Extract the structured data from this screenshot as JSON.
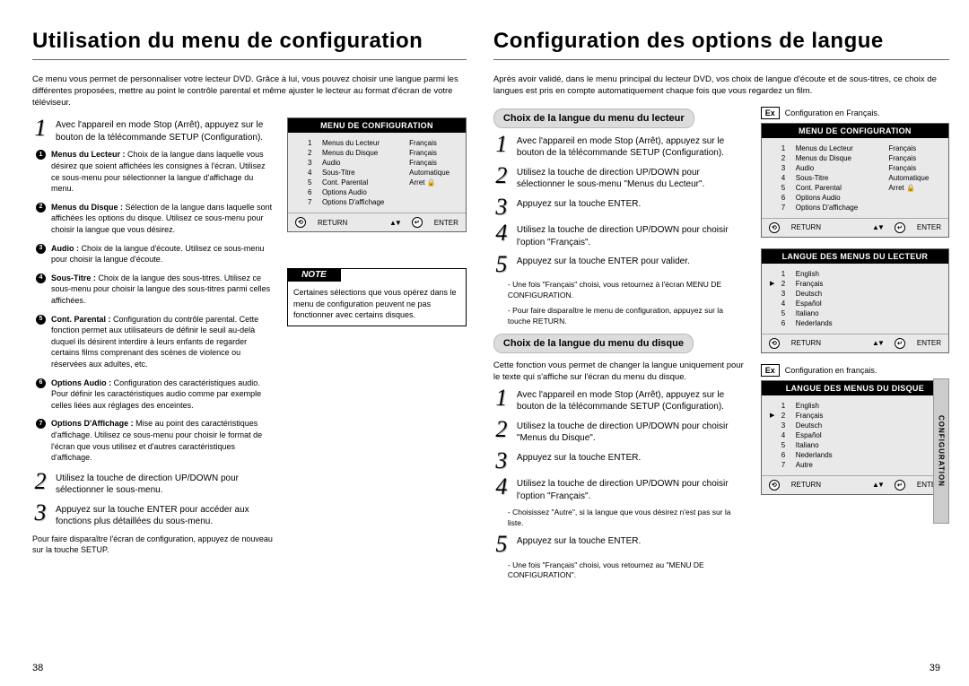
{
  "left": {
    "title": "Utilisation du menu de configuration",
    "intro": "Ce menu vous permet de personnaliser votre lecteur DVD. Grâce à lui, vous pouvez choisir une langue parmi les différentes proposées, mettre au point le contrôle parental et même ajuster le lecteur au format d'écran de votre téléviseur.",
    "step1": "Avec l'appareil en mode Stop (Arrêt), appuyez sur le bouton de la télécommande SETUP (Configuration).",
    "b1t": "Menus du Lecteur :",
    "b1": "Choix de la langue dans laquelle vous désirez que soient affichées les consignes à l'écran.\nUtilisez ce sous-menu pour sélectionner la langue d'affichage du menu.",
    "b2t": "Menus du Disque :",
    "b2": "Sélection de la langue dans laquelle sont affichées les options du disque. Utilisez ce sous-menu pour choisir la langue que vous désirez.",
    "b3t": "Audio :",
    "b3": "Choix de la langue d'écoute.\nUtilisez ce sous-menu pour choisir la langue d'écoute.",
    "b4t": "Sous-Titre :",
    "b4": "Choix de la langue des sous-titres. Utilisez ce sous-menu pour choisir la langue des sous-titres parmi celles affichées.",
    "b5t": "Cont. Parental :",
    "b5": "Configuration du contrôle parental.\nCette fonction permet aux utilisateurs de définir le seuil au-delà duquel ils désirent interdire à leurs enfants de regarder certains films comprenant des scènes de violence ou réservées aux adultes, etc.",
    "b6t": "Options Audio :",
    "b6": "Configuration des caractéristiques audio.\nPour définir les caractéristiques audio comme par exemple celles liées aux réglages des enceintes.",
    "b7t": "Options D'Affichage :",
    "b7": "Mise au point des caractéristiques d'affichage. Utilisez ce sous-menu pour choisir le format de l'écran que vous utilisez et d'autres caractéristiques d'affichage.",
    "step2": "Utilisez la touche de direction UP/DOWN pour sélectionner le sous-menu.",
    "step3": "Appuyez sur la touche ENTER pour accéder aux fonctions plus détaillées du sous-menu.",
    "footnote": "Pour faire disparaître l'écran de configuration, appuyez de nouveau sur la touche SETUP.",
    "osd": {
      "title": "MENU DE CONFIGURATION",
      "items": [
        {
          "n": "1",
          "l": "Menus du Lecteur",
          "v": "Français"
        },
        {
          "n": "2",
          "l": "Menus du Disque",
          "v": "Français"
        },
        {
          "n": "3",
          "l": "Audio",
          "v": "Français"
        },
        {
          "n": "4",
          "l": "Sous-Titre",
          "v": "Automatique"
        },
        {
          "n": "5",
          "l": "Cont. Parental",
          "v": "Arret 🔒"
        },
        {
          "n": "6",
          "l": "Options Audio",
          "v": ""
        },
        {
          "n": "7",
          "l": "Options D'affichage",
          "v": ""
        }
      ],
      "return": "RETURN",
      "enter": "ENTER"
    },
    "note_h": "NOTE",
    "note": "Certaines sélections que vous opérez dans le menu de configuration peuvent ne pas fonctionner avec certains disques.",
    "page": "38"
  },
  "right": {
    "title": "Configuration des options de langue",
    "intro": "Après avoir validé, dans le menu principal du lecteur DVD, vos choix de langue d'écoute et de sous-titres, ce choix de langues est pris en compte automatiquement chaque fois que vous regardez un film.",
    "pill1": "Choix de la langue du menu du lecteur",
    "a1": "Avec l'appareil en mode Stop (Arrêt), appuyez sur le bouton de la télécommande SETUP (Configuration).",
    "a2": "Utilisez la touche de direction UP/DOWN pour sélectionner le sous-menu \"Menus du Lecteur\".",
    "a3": "Appuyez sur la touche ENTER.",
    "a4": "Utilisez la touche de direction UP/DOWN pour choisir l'option \"Français\".",
    "a5": "Appuyez sur la touche ENTER pour valider.",
    "a_sub1": "- Une fois \"Français\" choisi, vous retournez à l'écran MENU DE CONFIGURATION.",
    "a_sub2": "- Pour faire disparaître le menu de configuration, appuyez sur la touche RETURN.",
    "pill2": "Choix de la langue du menu du disque",
    "disc_intro": "Cette fonction vous permet de changer la langue uniquement pour le texte qui s'affiche sur l'écran du menu du disque.",
    "d1": "Avec l'appareil en mode Stop (Arrêt), appuyez sur le bouton de la télécommande SETUP (Configuration).",
    "d2": "Utilisez la touche de direction UP/DOWN pour choisir \"Menus du Disque\".",
    "d3": "Appuyez sur la touche ENTER.",
    "d4": "Utilisez la touche de direction UP/DOWN pour choisir l'option \"Français\".",
    "d_sub": "- Choisissez \"Autre\", si la langue que vous désirez n'est pas sur la liste.",
    "d5": "Appuyez sur la touche ENTER.",
    "d_sub2": "- Une fois \"Français\" choisi, vous retournez au \"MENU DE CONFIGURATION\".",
    "ex1": "Configuration en Français.",
    "ex2": "Configuration en français.",
    "ex_label": "Ex",
    "osd1": {
      "title": "MENU DE CONFIGURATION",
      "items": [
        {
          "n": "1",
          "l": "Menus du Lecteur",
          "v": "Français"
        },
        {
          "n": "2",
          "l": "Menus du Disque",
          "v": "Français"
        },
        {
          "n": "3",
          "l": "Audio",
          "v": "Français"
        },
        {
          "n": "4",
          "l": "Sous-Titre",
          "v": "Automatique"
        },
        {
          "n": "5",
          "l": "Cont. Parental",
          "v": "Arret 🔒"
        },
        {
          "n": "6",
          "l": "Options Audio",
          "v": ""
        },
        {
          "n": "7",
          "l": "Options D'affichage",
          "v": ""
        }
      ],
      "return": "RETURN",
      "enter": "ENTER"
    },
    "osd2": {
      "title": "LANGUE DES MENUS DU LECTEUR",
      "items": [
        {
          "n": "1",
          "l": "English",
          "sel": false
        },
        {
          "n": "2",
          "l": "Français",
          "sel": true
        },
        {
          "n": "3",
          "l": "Deutsch",
          "sel": false
        },
        {
          "n": "4",
          "l": "Español",
          "sel": false
        },
        {
          "n": "5",
          "l": "Italiano",
          "sel": false
        },
        {
          "n": "6",
          "l": "Nederlands",
          "sel": false
        }
      ],
      "return": "RETURN",
      "enter": "ENTER"
    },
    "osd3": {
      "title": "LANGUE DES MENUS DU DISQUE",
      "items": [
        {
          "n": "1",
          "l": "English",
          "sel": false
        },
        {
          "n": "2",
          "l": "Français",
          "sel": true
        },
        {
          "n": "3",
          "l": "Deutsch",
          "sel": false
        },
        {
          "n": "4",
          "l": "Español",
          "sel": false
        },
        {
          "n": "5",
          "l": "Italiano",
          "sel": false
        },
        {
          "n": "6",
          "l": "Nederlands",
          "sel": false
        },
        {
          "n": "7",
          "l": "Autre",
          "sel": false
        }
      ],
      "return": "RETURN",
      "enter": "ENTER"
    },
    "tab": "CONFIGURATION",
    "page": "39"
  }
}
